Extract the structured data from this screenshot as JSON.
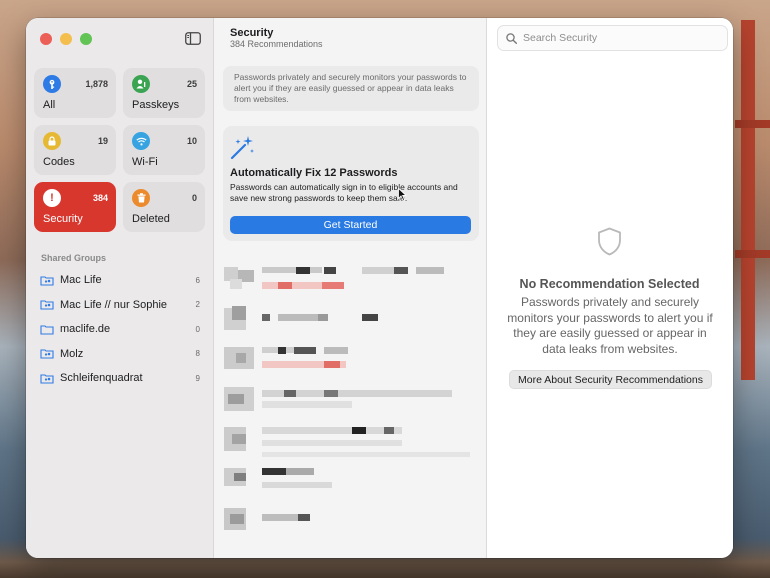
{
  "sidebar": {
    "categories": [
      {
        "label": "All",
        "count": "1,878",
        "icon": "key-icon",
        "color": "#2f7be5"
      },
      {
        "label": "Passkeys",
        "count": "25",
        "icon": "person-key-icon",
        "color": "#3aa453"
      },
      {
        "label": "Codes",
        "count": "19",
        "icon": "lock-clock-icon",
        "color": "#e6b934"
      },
      {
        "label": "Wi-Fi",
        "count": "10",
        "icon": "wifi-icon",
        "color": "#37a3e0"
      },
      {
        "label": "Security",
        "count": "384",
        "icon": "exclamation-icon",
        "color": "#ffffff"
      },
      {
        "label": "Deleted",
        "count": "0",
        "icon": "trash-icon",
        "color": "#ec8a2e"
      }
    ],
    "shared_groups_title": "Shared Groups",
    "groups": [
      {
        "name": "Mac Life",
        "count": "6",
        "icon": "shared-folder-icon"
      },
      {
        "name": "Mac Life // nur Sophie",
        "count": "2",
        "icon": "shared-folder-icon"
      },
      {
        "name": "maclife.de",
        "count": "0",
        "icon": "folder-icon"
      },
      {
        "name": "Molz",
        "count": "8",
        "icon": "shared-folder-icon"
      },
      {
        "name": "Schleifenquadrat",
        "count": "9",
        "icon": "shared-folder-icon"
      }
    ]
  },
  "middle": {
    "title": "Security",
    "subtitle": "384 Recommendations",
    "info_text": "Passwords privately and securely monitors your passwords to alert you if they are easily guessed or appear in data leaks from websites.",
    "fix": {
      "title": "Automatically Fix 12 Passwords",
      "description": "Passwords can automatically sign in to eligible accounts and save new strong passwords to keep them safe.",
      "button": "Get Started"
    }
  },
  "right": {
    "search_placeholder": "Search Security",
    "empty_title": "No Recommendation Selected",
    "empty_description": "Passwords privately and securely monitors your passwords to alert you if they are easily guessed or appear in data leaks from websites.",
    "more_button": "More About Security Recommendations"
  },
  "colors": {
    "accent": "#2a7ae3",
    "security_active": "#d8372e"
  }
}
